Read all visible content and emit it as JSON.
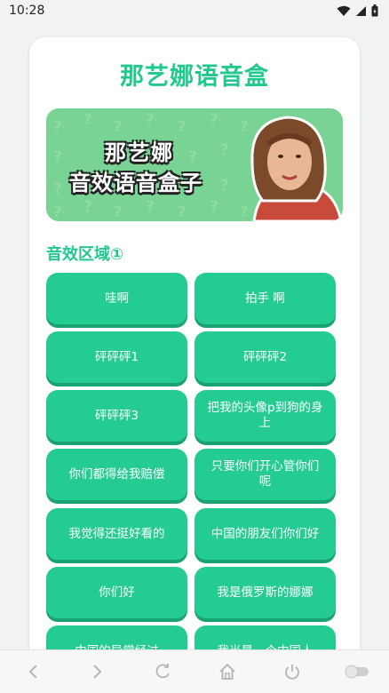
{
  "status_bar": {
    "time": "10:28"
  },
  "app": {
    "title": "那艺娜语音盒"
  },
  "banner": {
    "line1": "那艺娜",
    "line2": "音效语音盒子"
  },
  "section": {
    "title": "音效区域①"
  },
  "sound_buttons": [
    "哇啊",
    "拍手 啊",
    "砰砰砰1",
    "砰砰砰2",
    "砰砰砰3",
    "把我的头像p到狗的身上",
    "你们都得给我赔偿",
    "只要你们开心管你们呢",
    "我觉得还挺好看的",
    "中国的朋友们你们好",
    "你们好",
    "我是俄罗斯的娜娜",
    "中国的异常经过",
    "我光是一个中国人"
  ],
  "colors": {
    "accent": "#21c98e",
    "button": "#25cc92",
    "button_shadow": "#18a371"
  }
}
